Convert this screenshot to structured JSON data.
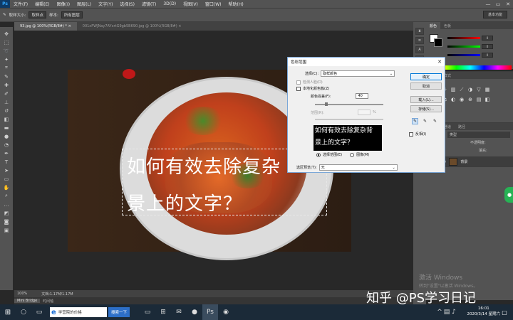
{
  "app": {
    "logo": "Ps",
    "menu": [
      "文件(F)",
      "编辑(E)",
      "图像(I)",
      "图层(L)",
      "文字(Y)",
      "选择(S)",
      "滤镜(T)",
      "3D(D)",
      "视图(V)",
      "窗口(W)",
      "帮助(H)"
    ],
    "window_controls": [
      "—",
      "▭",
      "✕"
    ]
  },
  "options": {
    "feather_label": "取样大小:",
    "feather_value": "取样点",
    "style_label": "样本:",
    "style_value": "所有图层",
    "workspace": "基本功能"
  },
  "tabs": [
    {
      "label": "93.jpg @ 100%(RGB/8#) * ×"
    },
    {
      "label": "001xFWJNay7AYxrtG9gb5B690.jpg @ 100%(RGB/8#) ×"
    }
  ],
  "canvas": {
    "overlay_line1": "如何有效去除复杂",
    "overlay_line2": "景上的文字？"
  },
  "status": {
    "zoom": "100%",
    "doc": "文档:1.17M/1.17M"
  },
  "bridge": {
    "tab1": "Mini Bridge",
    "tab2": "时间轴"
  },
  "panels": {
    "color_tabs": [
      "颜色",
      "色板"
    ],
    "slider_values": [
      "0",
      "0",
      "0"
    ],
    "styles_tabs": [
      "调整",
      "样式"
    ],
    "layers_tabs": [
      "图层",
      "通道",
      "路径"
    ],
    "kind_label": "类型",
    "opacity_label": "不透明度:",
    "fill_label": "填充:",
    "layer_name": "背景"
  },
  "dialog": {
    "title": "色彩范围",
    "close": "✕",
    "select_label": "选择(C):",
    "select_value": "取样颜色",
    "detect_faces": "检测人脸(D)",
    "localized": "本地化颜色簇(Z)",
    "fuzziness_label": "颜色容差(F):",
    "fuzziness_value": "40",
    "range_label": "范围(R):",
    "range_unit": "%",
    "preview_line1": "如何有效去除复杂背",
    "preview_line2": "景上的文字？",
    "radio_selection": "选择范围(E)",
    "radio_image": "图像(M)",
    "preview_label": "选区预览(T):",
    "preview_value": "无",
    "btn_ok": "确定",
    "btn_cancel": "取消",
    "btn_load": "载入(L)...",
    "btn_save": "存储(S)...",
    "invert": "反相(I)"
  },
  "taskbar": {
    "search_placeholder": "学营院的价格",
    "search_button": "搜索一下",
    "time": "16:01",
    "date": "2020/3/14 星期六"
  },
  "activation": {
    "line1": "激活 Windows",
    "line2": "转到\"设置\"以激活 Windows。"
  },
  "watermark": "知乎 @PS学习日记",
  "colors": {
    "accent": "#0078d7",
    "ps_blue": "#31a8ff",
    "panel": "#535353"
  }
}
